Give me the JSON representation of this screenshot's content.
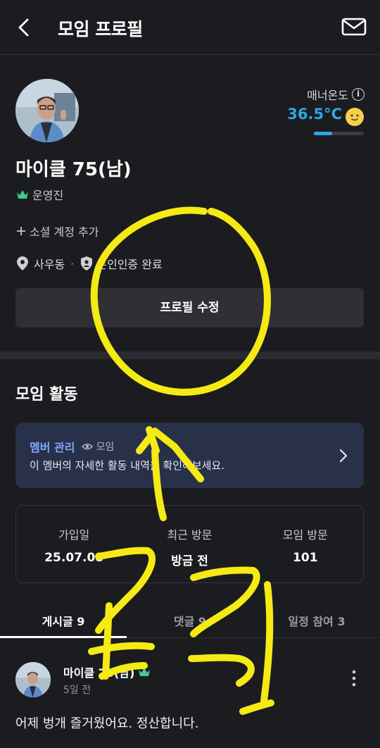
{
  "header": {
    "title": "모임 프로필"
  },
  "profile": {
    "manner_label": "매너온도",
    "temperature": "36.5°C",
    "temperature_fill": 0.36,
    "name": "마이클 75(남)",
    "operator_label": "운영진",
    "add_social": "소셜 계정 추가",
    "location": "사우동",
    "verification": "본인인증 완료",
    "edit_button": "프로필 수정"
  },
  "activity": {
    "title": "모임 활동",
    "member_mgmt_title": "멤버 관리",
    "member_mgmt_sub": "모임",
    "member_mgmt_desc": "이 멤버의 자세한 활동 내역을 확인해보세요.",
    "stats": [
      {
        "label": "가입일",
        "value": "25.07.08"
      },
      {
        "label": "최근 방문",
        "value": "방금 전"
      },
      {
        "label": "모임 방문",
        "value": "101"
      }
    ]
  },
  "tabs": [
    {
      "label": "게시글 9",
      "active": true
    },
    {
      "label": "댓글 9",
      "active": false
    },
    {
      "label": "일정 참여 3",
      "active": false
    }
  ],
  "post": {
    "author": "마이클 75(남)",
    "time": "5일 전",
    "text": "어제 벙개 즐거웠어요. 정산합니다."
  },
  "annotation": {
    "text": "클릭",
    "color": "#f5ea14"
  },
  "colors": {
    "background": "#1b1c20",
    "accent_blue": "#2ea7e6",
    "crown_green": "#3fce8c"
  }
}
